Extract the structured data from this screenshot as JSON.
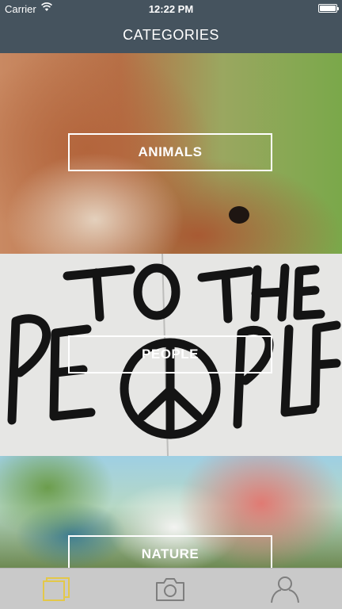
{
  "status_bar": {
    "carrier": "Carrier",
    "time": "12:22 PM"
  },
  "nav": {
    "title": "CATEGORIES"
  },
  "categories": [
    {
      "label": "ANIMALS"
    },
    {
      "label": "PEOPLE"
    },
    {
      "label": "NATURE"
    }
  ],
  "tabbar": {
    "items": [
      {
        "icon": "gallery-icon",
        "active": true
      },
      {
        "icon": "camera-icon",
        "active": false
      },
      {
        "icon": "profile-icon",
        "active": false
      }
    ]
  },
  "colors": {
    "nav_bg": "#45535e",
    "tab_active": "#e3c84a",
    "tab_inactive": "#7e7e7e",
    "tabbar_bg": "#c9c9c9"
  }
}
